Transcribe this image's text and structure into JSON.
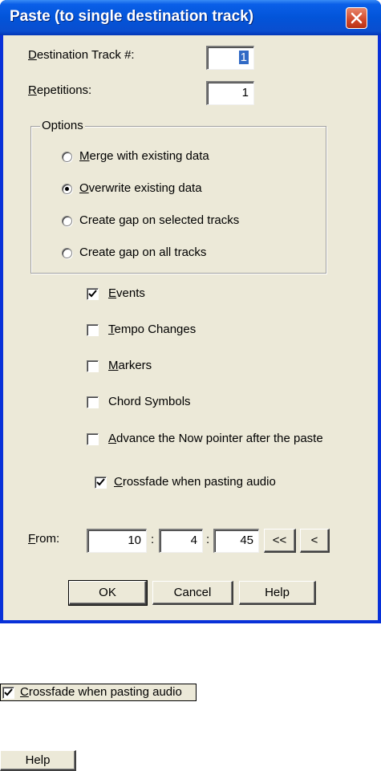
{
  "dialog": {
    "title": "Paste (to single destination track)",
    "destination_label": "Destination Track #:",
    "destination_value": "1",
    "repetitions_label": "Repetitions:",
    "repetitions_value": "1",
    "options_label": "Options",
    "radios": [
      {
        "label": "Merge with existing data",
        "selected": false
      },
      {
        "label": "Overwrite existing data",
        "selected": true
      },
      {
        "label": "Create gap on selected tracks",
        "selected": false
      },
      {
        "label": "Create gap on all tracks",
        "selected": false
      }
    ],
    "checkboxes": [
      {
        "label": "Events",
        "checked": true
      },
      {
        "label": "Tempo Changes",
        "checked": false
      },
      {
        "label": "Markers",
        "checked": false
      },
      {
        "label": "Chord Symbols",
        "checked": false
      },
      {
        "label": "Advance the Now pointer after the paste",
        "checked": false
      },
      {
        "label": "Crossfade when pasting audio",
        "checked": true
      }
    ],
    "from_label": "From:",
    "from_values": [
      "10",
      "4",
      "45"
    ],
    "from_separator": ":",
    "rewind_all_label": "<<",
    "rewind_label": "<",
    "ok_label": "OK",
    "cancel_label": "Cancel",
    "help_label": "Help"
  },
  "extras": {
    "crossfade_label": "Crossfade when pasting audio",
    "crossfade_checked": true,
    "help_label": "Help"
  },
  "colors": {
    "titlebar": "#0254d9",
    "dialog_bg": "#ece9d8",
    "close_button": "#d0482a",
    "selection": "#316ac5"
  }
}
